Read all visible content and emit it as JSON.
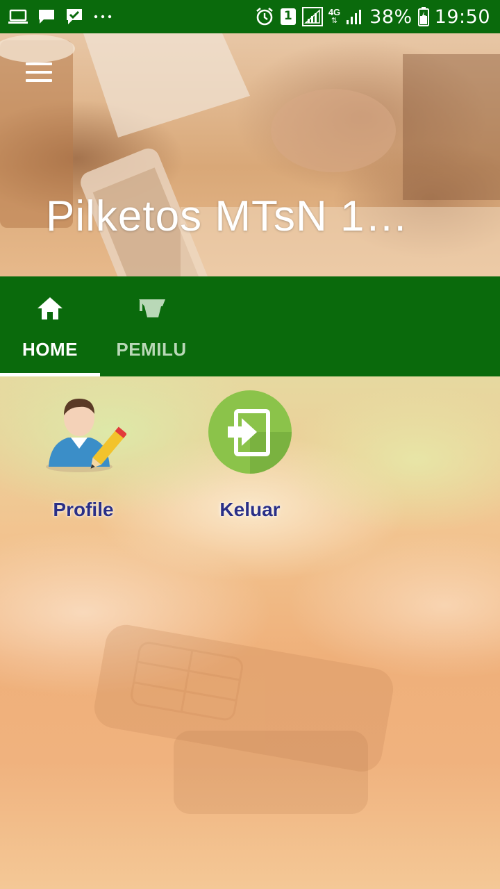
{
  "status_bar": {
    "battery": "38%",
    "time": "19:50",
    "sim_slot": "1",
    "network": "4G",
    "left_icons": [
      "laptop-icon",
      "chat-icon",
      "check-message-icon",
      "more-dots-icon"
    ],
    "right_icons": [
      "alarm-icon",
      "sim-icon",
      "signal-icon",
      "signal-icon",
      "battery-icon"
    ]
  },
  "header": {
    "title": "Pilketos MTsN 1…",
    "menu_icon": "hamburger-icon"
  },
  "tabs": [
    {
      "label": "HOME",
      "icon": "home-icon",
      "active": true
    },
    {
      "label": "PEMILU",
      "icon": "graduation-cap-icon",
      "active": false
    }
  ],
  "tiles": [
    {
      "label": "Profile",
      "icon": "user-edit-icon"
    },
    {
      "label": "Keluar",
      "icon": "exit-icon"
    }
  ],
  "colors": {
    "primary_green": "#0a6a0c",
    "tab_inactive": "#b9d8b7",
    "tile_label": "#2a2f86",
    "exit_icon_green": "#8bc34a"
  }
}
